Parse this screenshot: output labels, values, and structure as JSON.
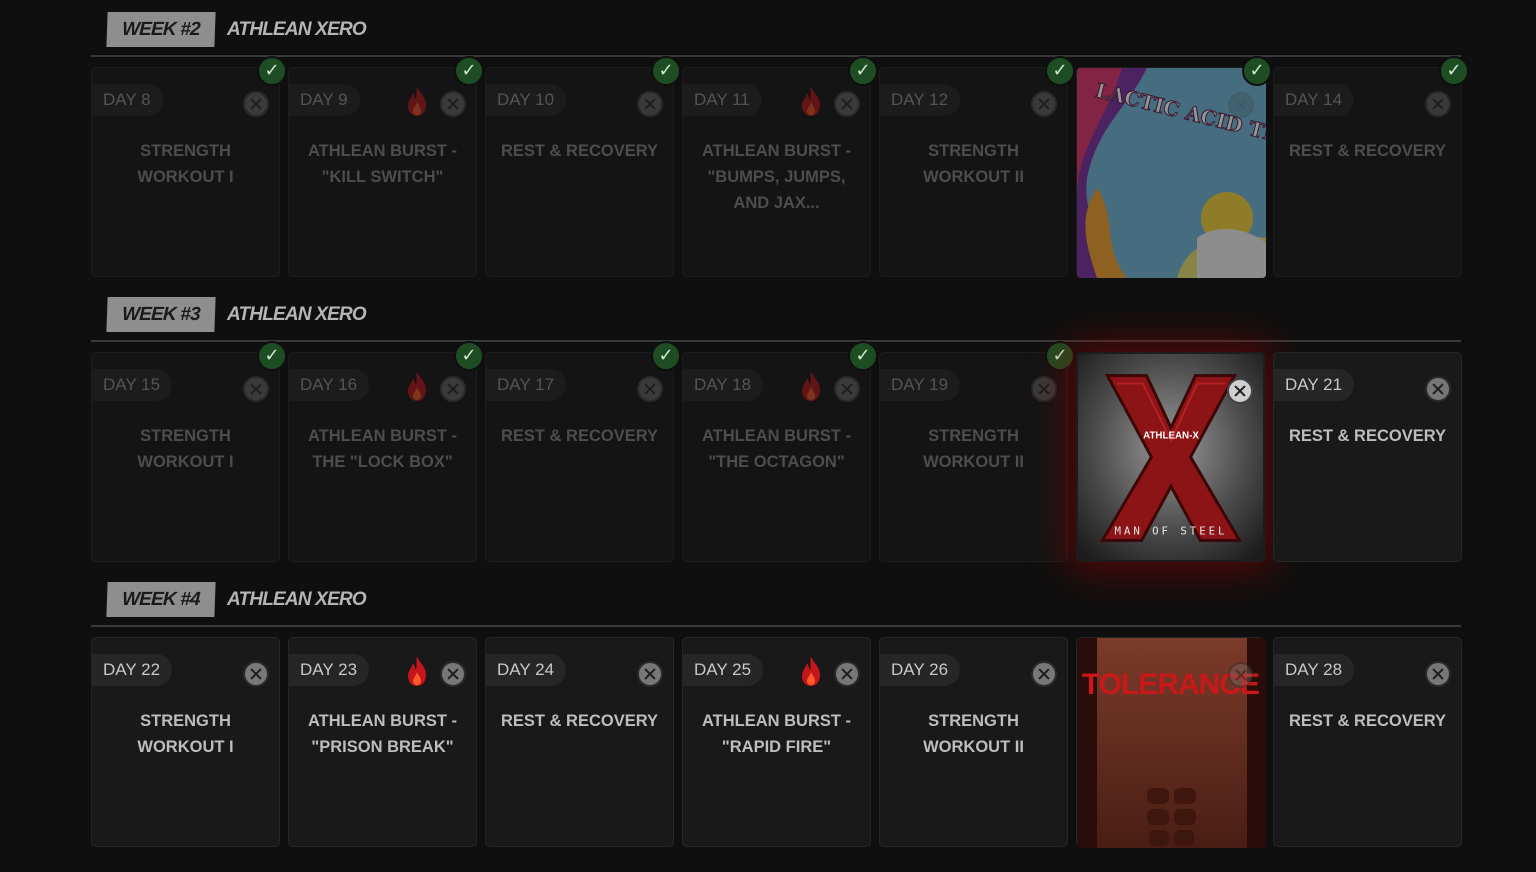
{
  "weeks": [
    {
      "tag": "WEEK #2",
      "program": "ATHLEAN XERO",
      "days": [
        {
          "label": "DAY 8",
          "title": "STRENGTH WORKOUT I",
          "fire": false
        },
        {
          "label": "DAY 9",
          "title": "ATHLEAN BURST - \"KILL SWITCH\"",
          "fire": true
        },
        {
          "label": "DAY 10",
          "title": "REST & RECOVERY",
          "fire": false
        },
        {
          "label": "DAY 11",
          "title": "ATHLEAN BURST - \"BUMPS, JUMPS, AND JAX...",
          "fire": true
        },
        {
          "label": "DAY 12",
          "title": "STRENGTH WORKOUT II",
          "fire": false
        },
        {
          "challenge": "LACTIC ACID TRIP CHALLENGE",
          "challenge_id": "lactic"
        },
        {
          "label": "DAY 14",
          "title": "REST & RECOVERY",
          "fire": false
        }
      ]
    },
    {
      "tag": "WEEK #3",
      "program": "ATHLEAN XERO",
      "days": [
        {
          "label": "DAY 15",
          "title": "STRENGTH WORKOUT I",
          "fire": false
        },
        {
          "label": "DAY 16",
          "title": "ATHLEAN BURST - THE \"LOCK BOX\"",
          "fire": true
        },
        {
          "label": "DAY 17",
          "title": "REST & RECOVERY",
          "fire": false
        },
        {
          "label": "DAY 18",
          "title": "ATHLEAN BURST - \"THE OCTAGON\"",
          "fire": true
        },
        {
          "label": "DAY 19",
          "title": "STRENGTH WORKOUT II",
          "fire": false
        },
        {
          "challenge": "MAN OF STEEL",
          "brand": "ATHLEAN-X",
          "challenge_id": "steel"
        },
        {
          "label": "DAY 21",
          "title": "REST & RECOVERY",
          "fire": false
        }
      ]
    },
    {
      "tag": "WEEK #4",
      "program": "ATHLEAN XERO",
      "days": [
        {
          "label": "DAY 22",
          "title": "STRENGTH WORKOUT I",
          "fire": false
        },
        {
          "label": "DAY 23",
          "title": "ATHLEAN BURST - \"PRISON BREAK\"",
          "fire": true
        },
        {
          "label": "DAY 24",
          "title": "REST & RECOVERY",
          "fire": false
        },
        {
          "label": "DAY 25",
          "title": "ATHLEAN BURST - \"RAPID FIRE\"",
          "fire": true
        },
        {
          "label": "DAY 26",
          "title": "STRENGTH WORKOUT II",
          "fire": false
        },
        {
          "challenge": "XERO TOLERANCE",
          "challenge_id": "xero"
        },
        {
          "label": "DAY 28",
          "title": "REST & RECOVERY",
          "fire": false
        }
      ]
    }
  ],
  "icons": {
    "check": "✓"
  },
  "colors": {
    "fire": "#c4161c",
    "check_badge": "#1f4d23",
    "active_glow": "#960000"
  }
}
